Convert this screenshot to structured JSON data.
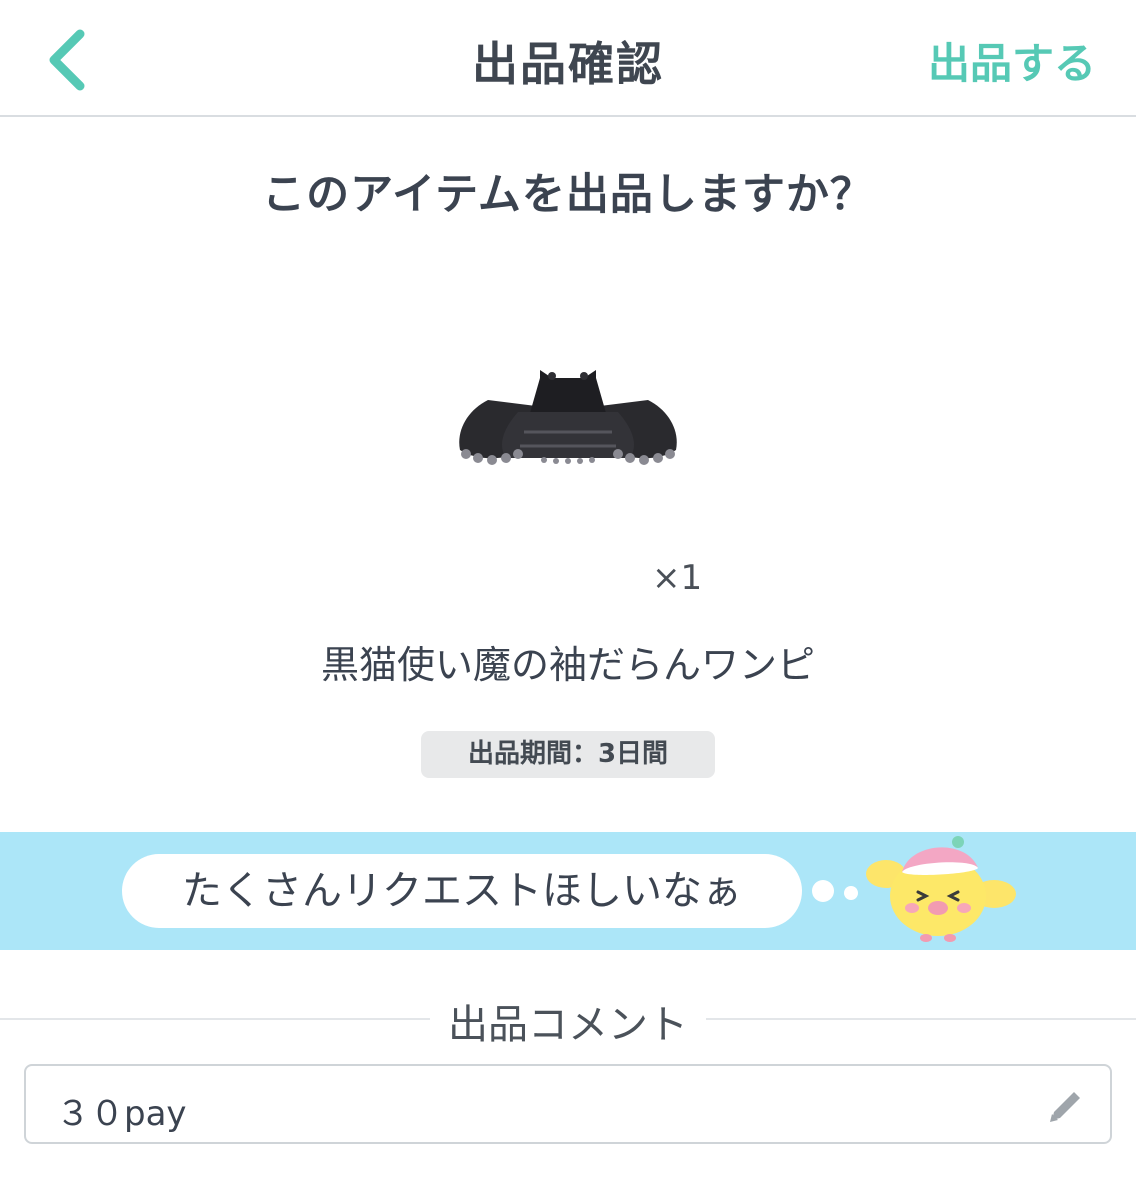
{
  "header": {
    "back_icon": "chevron-left-icon",
    "title": "出品確認",
    "submit_label": "出品する",
    "accent_color": "#56c9b5"
  },
  "confirm": {
    "question": "このアイテムを出品しますか？",
    "item_image": "black-frilled-dress",
    "quantity": "×1",
    "item_name": "黒猫使い魔の袖だらんワンピ",
    "period": "出品期間：3日間"
  },
  "banner": {
    "message": "たくさんリクエストほしいなぁ",
    "mascot": "yellow-bird-mascot",
    "background_color": "#ace6f8"
  },
  "comment": {
    "section_title": "出品コメント",
    "value": "３０pay",
    "edit_icon": "pencil-icon"
  }
}
